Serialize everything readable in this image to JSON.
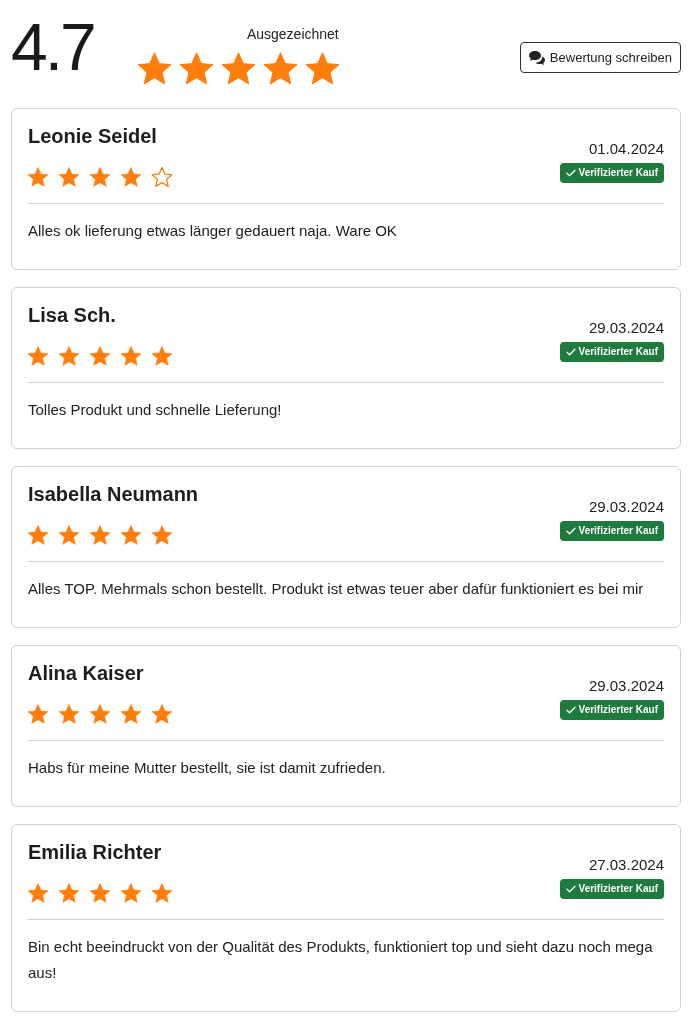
{
  "summary": {
    "score": "4.7",
    "rating_label": "Ausgezeichnet",
    "stars": 5
  },
  "write_review_button": {
    "label": "Bewertung schreiben"
  },
  "reviews": [
    {
      "name": "Leonie Seidel",
      "date": "01.04.2024",
      "stars": 4,
      "badge": "Verifizierter Kauf",
      "text": "Alles ok lieferung etwas länger gedauert naja. Ware OK"
    },
    {
      "name": "Lisa Sch.",
      "date": "29.03.2024",
      "stars": 5,
      "badge": "Verifizierter Kauf",
      "text": "Tolles Produkt und schnelle Lieferung!"
    },
    {
      "name": "Isabella Neumann",
      "date": "29.03.2024",
      "stars": 5,
      "badge": "Verifizierter Kauf",
      "text": "Alles TOP. Mehrmals schon bestellt. Produkt ist etwas teuer aber dafür funktioniert es bei mir"
    },
    {
      "name": "Alina Kaiser",
      "date": "29.03.2024",
      "stars": 5,
      "badge": "Verifizierter Kauf",
      "text": "Habs für meine Mutter bestellt, sie ist damit zufrieden."
    },
    {
      "name": "Emilia Richter",
      "date": "27.03.2024",
      "stars": 5,
      "badge": "Verifizierter Kauf",
      "text": "Bin echt beeindruckt von der Qualität des Produkts, funktioniert top und sieht dazu noch mega aus!"
    }
  ]
}
